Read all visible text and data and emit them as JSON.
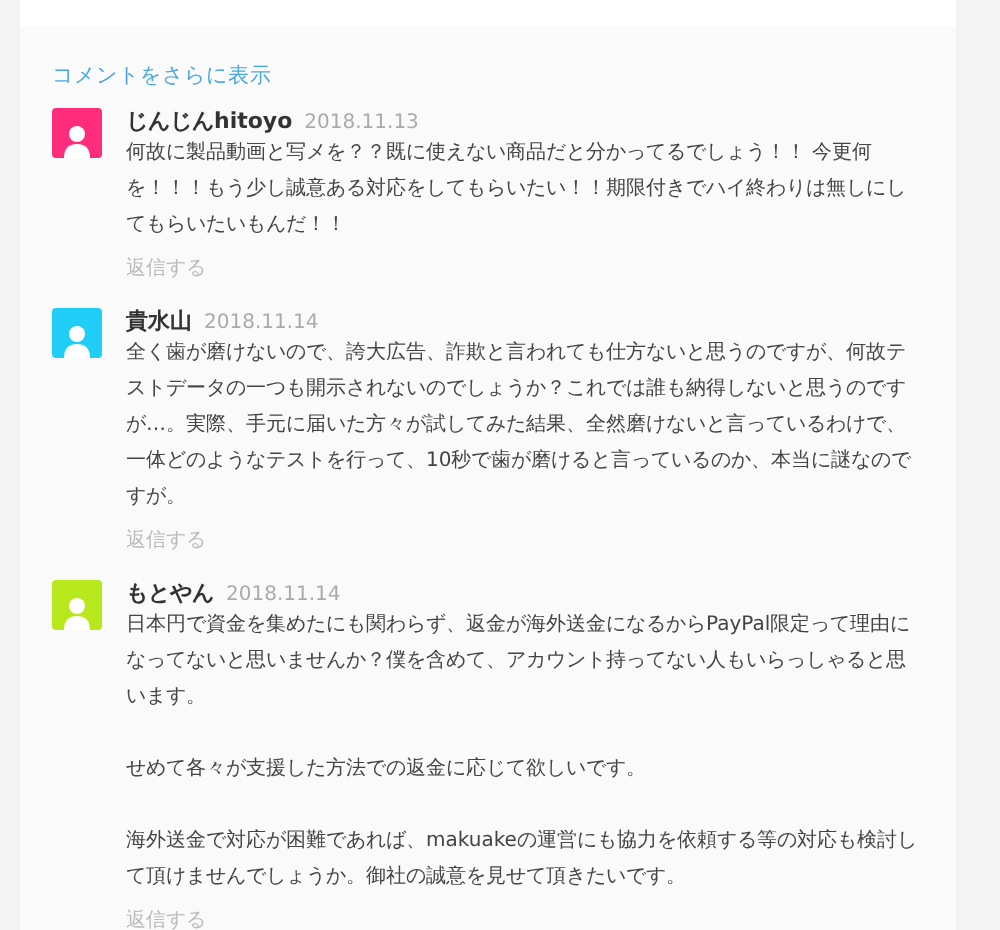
{
  "more_comments_link": "コメントをさらに表示",
  "comments": [
    {
      "author": "じんじんhitoyo",
      "date": "2018.11.13",
      "color": "#fe2c7b",
      "body": "何故に製品動画と写メを？？既に使えない商品だと分かってるでしょう！！ 今更何を！！！もう少し誠意ある対応をしてもらいたい！！期限付きでハイ終わりは無しにしてもらいたいもんだ！！",
      "reply": "返信する"
    },
    {
      "author": "貴水山",
      "date": "2018.11.14",
      "color": "#1fcdf6",
      "body": "全く歯が磨けないので、誇大広告、詐欺と言われても仕方ないと思うのですが、何故テストデータの一つも開示されないのでしょうか？これでは誰も納得しないと思うのですが…。実際、手元に届いた方々が試してみた結果、全然磨けないと言っているわけで、一体どのようなテストを行って、10秒で歯が磨けると言っているのか、本当に謎なのですが。",
      "reply": "返信する"
    },
    {
      "author": "もとやん",
      "date": "2018.11.14",
      "color": "#b6e81c",
      "body": "日本円で資金を集めたにも関わらず、返金が海外送金になるからPayPal限定って理由になってないと思いませんか？僕を含めて、アカウント持ってない人もいらっしゃると思います。",
      "more_paragraphs": [
        "せめて各々が支援した方法での返金に応じて欲しいです。",
        "海外送金で対応が困難であれば、makuakeの運営にも協力を依頼する等の対応も検討して頂けませんでしょうか。御社の誠意を見せて頂きたいです。"
      ],
      "reply": "返信する"
    }
  ]
}
